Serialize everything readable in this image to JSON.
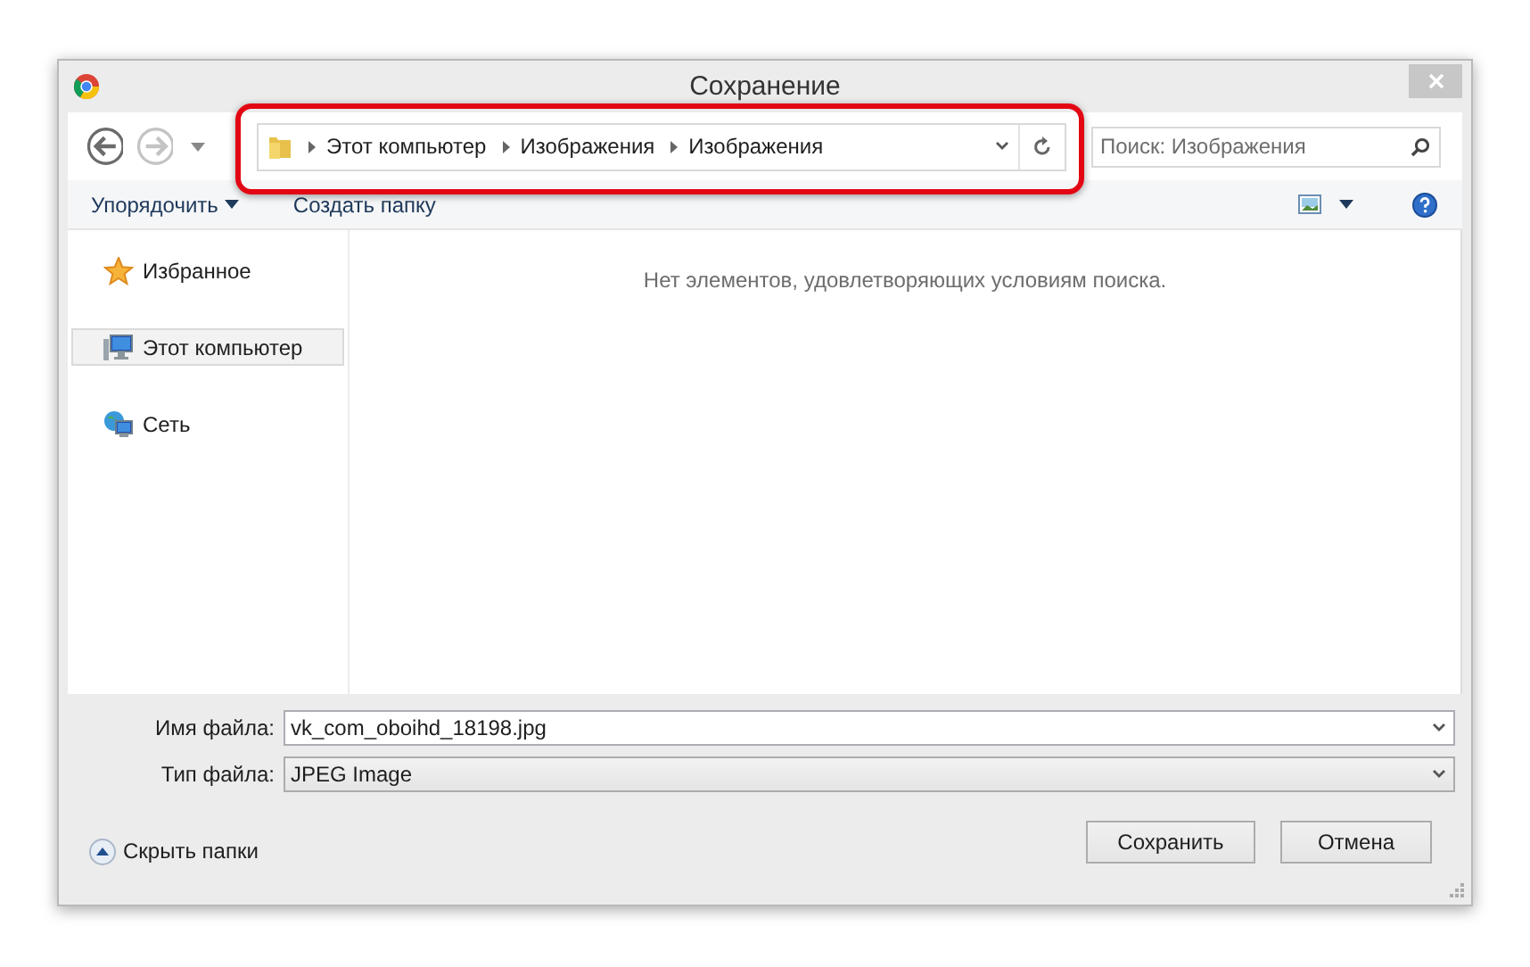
{
  "window": {
    "title": "Сохранение"
  },
  "nav_buttons": [
    {
      "kind": "back",
      "disabled": false
    },
    {
      "kind": "forward",
      "disabled": true
    }
  ],
  "address_bar": {
    "path": [
      "Этот компьютер",
      "Изображения",
      "Изображения"
    ]
  },
  "search": {
    "placeholder": "Поиск: Изображения"
  },
  "toolbar": {
    "organize": "Упорядочить",
    "new_folder": "Создать папку"
  },
  "sidebar": {
    "items": [
      {
        "label": "Избранное",
        "kind": "star",
        "selected": false
      },
      {
        "label": "Этот компьютер",
        "kind": "computer",
        "selected": true
      },
      {
        "label": "Сеть",
        "kind": "network",
        "selected": false
      }
    ]
  },
  "content": {
    "empty_message": "Нет элементов, удовлетворяющих условиям поиска."
  },
  "fields": [
    {
      "label": "Имя файла:",
      "value": "vk_com_oboihd_18198.jpg",
      "kind": "input"
    },
    {
      "label": "Тип файла:",
      "value": "JPEG Image",
      "kind": "select"
    }
  ],
  "hide_folders": "Скрыть папки",
  "buttons": [
    {
      "label": "Сохранить"
    },
    {
      "label": "Отмена"
    }
  ]
}
